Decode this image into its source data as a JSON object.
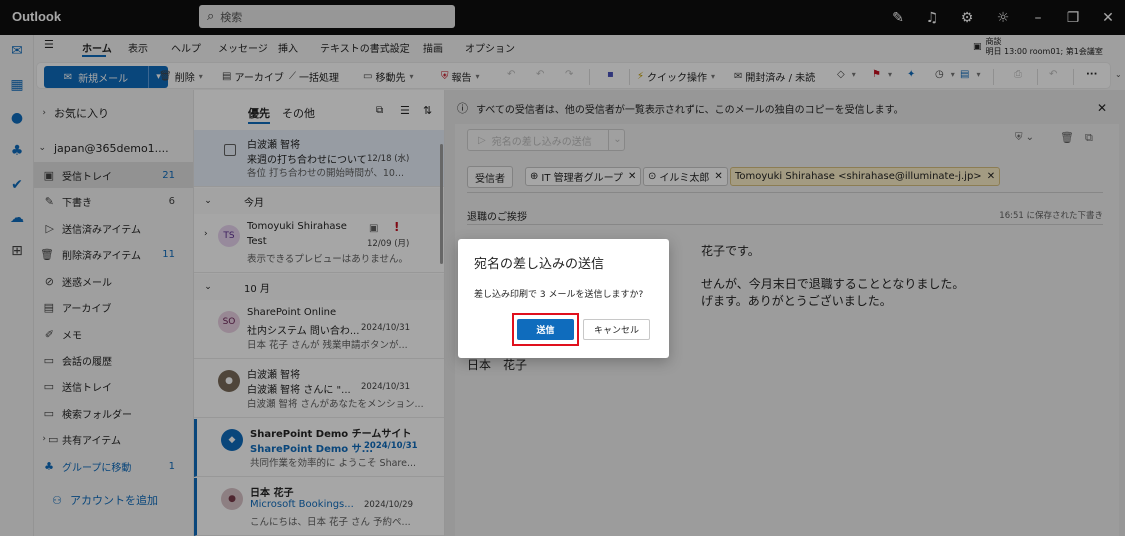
{
  "app": {
    "title": "Outlook"
  },
  "search": {
    "placeholder": "検索"
  },
  "tabs": [
    "ホーム",
    "表示",
    "ヘルプ",
    "メッセージ",
    "挿入",
    "テキストの書式設定",
    "描画",
    "オプション"
  ],
  "meeting": {
    "label": "商談",
    "detail": "明日 13:00 room01; 第1会議室"
  },
  "ribbon": {
    "new_mail": "新規メール",
    "delete": "削除",
    "archive": "アーカイブ",
    "sweep": "一括処理",
    "move": "移動先",
    "report": "報告",
    "quick_steps": "クイック操作",
    "read_unread": "開封済み / 未読"
  },
  "folders": {
    "favorites": "お気に入り",
    "account": "japan@365demo1....",
    "items": [
      {
        "label": "受信トレイ",
        "count": "21"
      },
      {
        "label": "下書き",
        "count": "6"
      },
      {
        "label": "送信済みアイテム",
        "count": ""
      },
      {
        "label": "削除済みアイテム",
        "count": "11"
      },
      {
        "label": "迷惑メール",
        "count": ""
      },
      {
        "label": "アーカイブ",
        "count": ""
      },
      {
        "label": "メモ",
        "count": ""
      },
      {
        "label": "会話の履歴",
        "count": ""
      },
      {
        "label": "送信トレイ",
        "count": ""
      },
      {
        "label": "検索フォルダー",
        "count": ""
      },
      {
        "label": "共有アイテム",
        "count": ""
      },
      {
        "label": "グループに移動",
        "count": "1"
      }
    ],
    "add_account": "アカウントを追加"
  },
  "list": {
    "tab_focused": "優先",
    "tab_other": "その他",
    "groups": {
      "this_month": "今月",
      "october": "10 月"
    },
    "messages": [
      {
        "from": "白波瀬 智将",
        "subject": "来週の打ち合わせについて",
        "date": "12/18 (水)",
        "preview": "各位 打ち合わせの開始時間が、10..."
      },
      {
        "from": "Tomoyuki Shirahase",
        "subject": "Test",
        "date": "12/09 (月)",
        "preview": "表示できるプレビューはありません。",
        "initials": "TS"
      },
      {
        "from": "SharePoint Online",
        "subject": "社内システム 問い合わ...",
        "date": "2024/10/31",
        "preview": "日本 花子 さんが 残業申請ボタンが...",
        "initials": "SO"
      },
      {
        "from": "白波瀬 智将",
        "subject": "白波瀬 智将 さんに \"...",
        "date": "2024/10/31",
        "preview": "白波瀬 智将 さんがあなたをメンション..."
      },
      {
        "from": "SharePoint Demo チームサイト",
        "subject": "SharePoint Demo サ...",
        "date": "2024/10/31",
        "preview": "共同作業を効率的に ようこそ Share..."
      },
      {
        "from": "日本 花子",
        "subject": "Microsoft Bookings...",
        "date": "2024/10/29",
        "preview": "こんにちは、日本 花子 さん 予約ペ..."
      }
    ]
  },
  "reading": {
    "info": "すべての受信者は、他の受信者が一覧表示されずに、このメールの独自のコピーを受信します。",
    "send_merge": "宛名の差し込みの送信",
    "to_label": "受信者",
    "recipients": [
      "IT 管理者グループ",
      "イルミ太郎",
      "Tomoyuki Shirahase <shirahase@illuminate-j.jp>"
    ],
    "subject": "退職のご挨拶",
    "saved": "16:51 に保存された下書き",
    "body": [
      "花子です。",
      "せんが、今月末日で退職することとなりました。",
      "げます。ありがとうございました。",
      "日本　花子"
    ]
  },
  "dialog": {
    "title": "宛名の差し込みの送信",
    "message": "差し込み印刷で 3 メールを送信しますか?",
    "send": "送信",
    "cancel": "キャンセル"
  },
  "colors": {
    "accent": "#0f6cbd",
    "highlight": "#e0101d",
    "flag": "#c50f1f"
  }
}
